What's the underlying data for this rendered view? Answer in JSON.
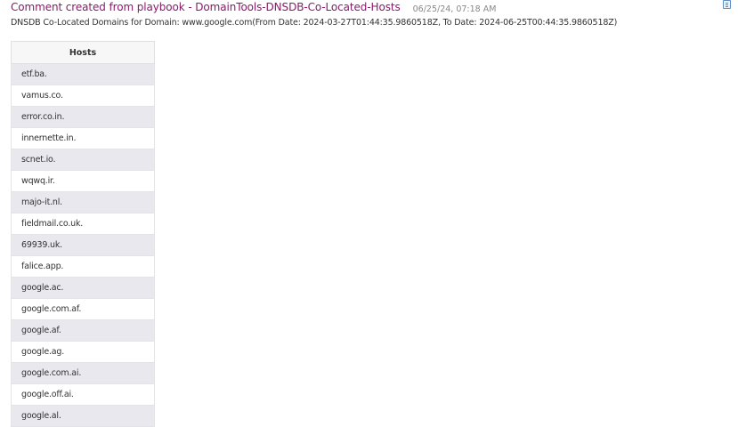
{
  "comment": {
    "title": "Comment created from playbook - DomainTools-DNSDB-Co-Located-Hosts",
    "timestamp": "06/25/24, 07:18 AM",
    "body": "DNSDB Co-Located Domains for Domain: www.google.com(From Date: 2024-03-27T01:44:35.9860518Z, To Date: 2024-06-25T00:44:35.9860518Z)"
  },
  "corner_icon": "document-list-icon",
  "table": {
    "header": "Hosts",
    "rows": [
      "etf.ba.",
      "vamus.co.",
      "error.co.in.",
      "innernette.in.",
      "scnet.io.",
      "wqwq.ir.",
      "majo-it.nl.",
      "fieldmail.co.uk.",
      "69939.uk.",
      "falice.app.",
      "google.ac.",
      "google.com.af.",
      "google.af.",
      "google.ag.",
      "google.com.ai.",
      "google.off.ai.",
      "google.al."
    ]
  }
}
